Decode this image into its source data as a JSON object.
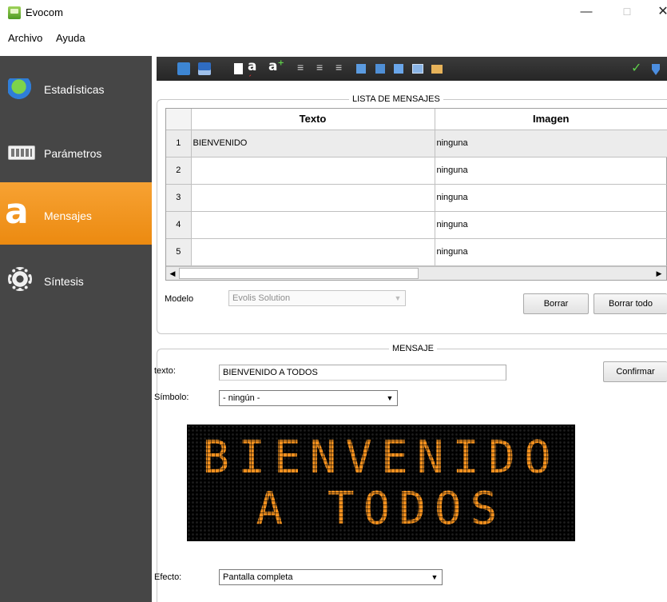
{
  "window": {
    "title": "Evocom",
    "icon": "app-icon",
    "minimize_glyph": "—",
    "maximize_glyph": "☐",
    "close_glyph": "✕"
  },
  "menu": {
    "items": [
      "Archivo",
      "Ayuda"
    ]
  },
  "sidebar": {
    "items": [
      {
        "label": "Estadísticas",
        "icon": "pie-chart-icon",
        "active": false
      },
      {
        "label": "Parámetros",
        "icon": "keyboard-panel-icon",
        "active": false
      },
      {
        "label": "Mensajes",
        "icon": "letter-a-icon",
        "active": true
      },
      {
        "label": "Síntesis",
        "icon": "gear-icon",
        "active": false
      }
    ],
    "colors": {
      "background": "#464646",
      "active": "#f09219"
    }
  },
  "toolbar": {
    "icons": [
      "open-folder-icon",
      "save-disk-icon",
      "blank-slide-icon",
      "font-red-icon",
      "font-green-icon",
      "align-left-icon",
      "align-center-icon",
      "align-right-icon",
      "valign-top-icon",
      "valign-middle-icon",
      "valign-bottom-icon",
      "add-image-icon",
      "add-panel-icon",
      "check-icon",
      "download-arrow-icon"
    ],
    "font_red_glyph": "a",
    "font_green_glyph": "a"
  },
  "message_list": {
    "legend": "LISTA DE MENSAJES",
    "columns": [
      "Texto",
      "Imagen"
    ],
    "rows": [
      {
        "n": "1",
        "texto": "BIENVENIDO",
        "imagen": "ninguna"
      },
      {
        "n": "2",
        "texto": "",
        "imagen": "ninguna"
      },
      {
        "n": "3",
        "texto": "",
        "imagen": "ninguna"
      },
      {
        "n": "4",
        "texto": "",
        "imagen": "ninguna"
      },
      {
        "n": "5",
        "texto": "",
        "imagen": "ninguna"
      }
    ],
    "modelo_label": "Modelo",
    "modelo_value": "Evolis Solution",
    "borrar_label": "Borrar",
    "borrar_todo_label": "Borrar todo"
  },
  "message_editor": {
    "legend": "MENSAJE",
    "texto_label": "texto:",
    "texto_value": "BIENVENIDO A TODOS",
    "confirmar_label": "Confirmar",
    "simbolo_label": "Símbolo:",
    "simbolo_value": "- ningún -",
    "efecto_label": "Efecto:",
    "efecto_value": "Pantalla completa"
  },
  "led_preview": {
    "line1": "BIENVENIDO",
    "line2": "A TODOS",
    "color": "#f1901f"
  }
}
